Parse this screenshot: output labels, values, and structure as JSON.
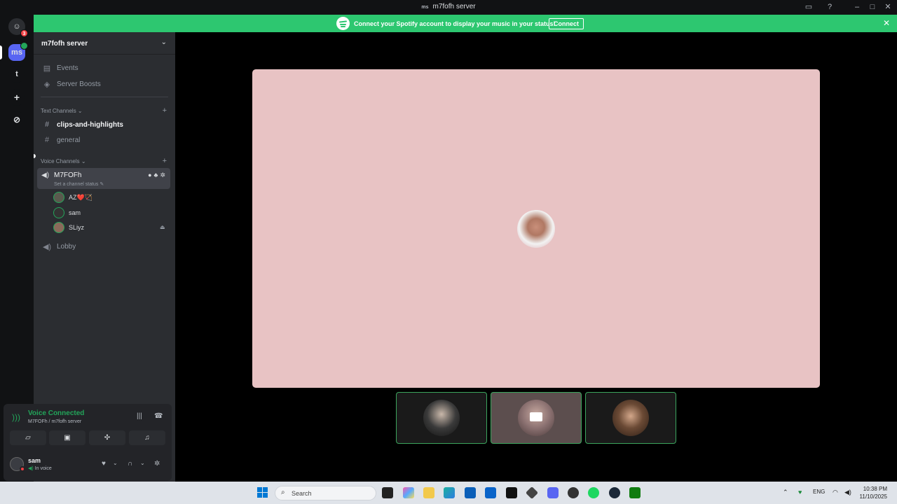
{
  "window": {
    "title": "m7fofh server",
    "icon_text": "ms"
  },
  "banner": {
    "message": "Connect your Spotify account to display your music in your status!",
    "connect_label": "Connect"
  },
  "guilds": [
    {
      "name": "home",
      "badge": "3"
    },
    {
      "name": "ms",
      "label": "ms",
      "badge": ""
    },
    {
      "name": "t",
      "label": "t"
    },
    {
      "name": "add-server",
      "label": "+"
    },
    {
      "name": "discover",
      "label": "⊘"
    }
  ],
  "sidebar": {
    "server_name": "m7fofh server",
    "events": "Events",
    "server_boosts": "Server Boosts",
    "text_channels_label": "Text Channels",
    "text_channels": [
      "clips-and-highlights",
      "general"
    ],
    "voice_channels_label": "Voice Channels",
    "active_voice": {
      "name": "M7FOFh",
      "status": "Set a channel status"
    },
    "voice_users": [
      "AZ❤️🏹",
      "sam",
      "SLiyz"
    ],
    "other_voice": "Lobby"
  },
  "voice_panel": {
    "title": "Voice Connected",
    "subtitle": "M7FOFh / m7fofh server"
  },
  "user": {
    "name": "sam",
    "status": "In voice"
  },
  "taskbar": {
    "search_placeholder": "Search",
    "lang": "ENG",
    "time": "10:38 PM",
    "date": "11/10/2025"
  },
  "colors": {
    "banner": "#2dc770",
    "voice_green": "#23a55a",
    "main_tile": "#e8c3c4",
    "accent": "#5865f2"
  }
}
